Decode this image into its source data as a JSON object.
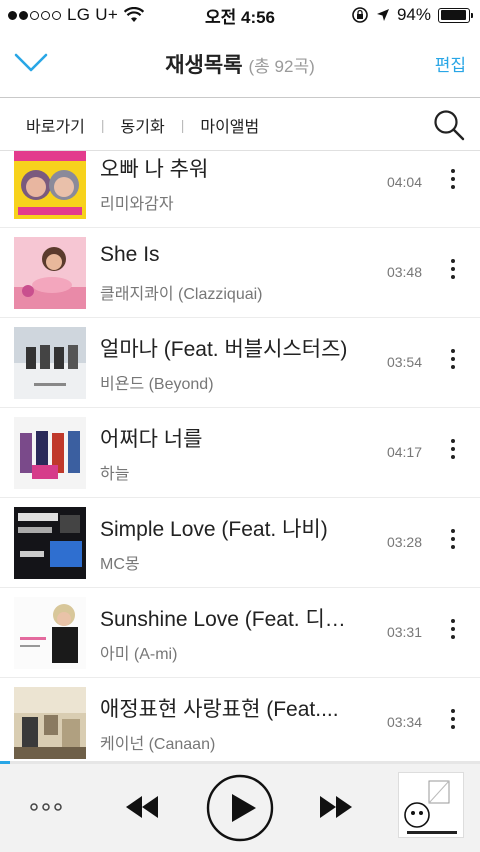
{
  "status": {
    "carrier": "LG U+",
    "time": "오전 4:56",
    "battery": "94%",
    "battery_level": 0.94
  },
  "header": {
    "title": "재생목록",
    "count": "(총 92곡)",
    "edit_label": "편집"
  },
  "tabs": [
    {
      "label": "바로가기"
    },
    {
      "label": "동기화"
    },
    {
      "label": "마이앨범"
    }
  ],
  "songs": [
    {
      "title": "오빠 나 추워",
      "artist": "리미와감자",
      "duration": "04:04"
    },
    {
      "title": "She Is",
      "artist": "클래지콰이 (Clazziquai)",
      "duration": "03:48"
    },
    {
      "title": "얼마나 (Feat. 버블시스터즈)",
      "artist": "비욘드 (Beyond)",
      "duration": "03:54"
    },
    {
      "title": "어쩌다 너를",
      "artist": "하늘",
      "duration": "04:17"
    },
    {
      "title": "Simple Love (Feat. 나비)",
      "artist": "MC몽",
      "duration": "03:28"
    },
    {
      "title": "Sunshine Love (Feat. 디…",
      "artist": "아미 (A-mi)",
      "duration": "03:31"
    },
    {
      "title": "애정표현 사랑표현 (Feat....",
      "artist": "케이넌 (Canaan)",
      "duration": "03:34"
    }
  ],
  "player": {
    "progress": 0.02
  },
  "colors": {
    "accent": "#29a6e6",
    "text": "#222222",
    "subtext": "#777777"
  }
}
